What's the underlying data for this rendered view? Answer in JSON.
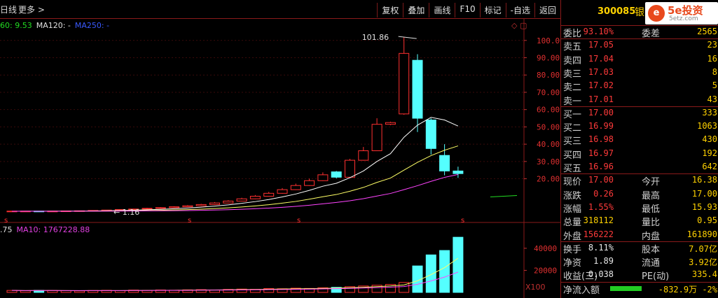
{
  "topbar": {
    "left_title": "日线",
    "more_label": "更多 >",
    "toolbar": [
      "复权",
      "叠加",
      "画线",
      "F10",
      "标记",
      "-自选",
      "返回"
    ]
  },
  "ma_line": [
    {
      "text": "60: 9.53",
      "color": "#22dd22"
    },
    {
      "text": "MA120: -",
      "color": "#e0e0e0"
    },
    {
      "text": "MA250: -",
      "color": "#3a5aff"
    }
  ],
  "vol_line": [
    {
      "text": ".75",
      "color": "#e0e0e0"
    },
    {
      "text": "MA10: 1767228.88",
      "color": "#e040e0"
    }
  ],
  "price_axis": {
    "ticks": [
      "100.00",
      "90.00",
      "80.00",
      "70.00",
      "60.00",
      "50.00",
      "40.00",
      "30.00",
      "20.00"
    ],
    "values": [
      100,
      90,
      80,
      70,
      60,
      50,
      40,
      30,
      20
    ]
  },
  "vol_axis": {
    "ticks": [
      "40000",
      "20000"
    ],
    "values": [
      40000,
      20000
    ],
    "unit": "X100"
  },
  "annotations": {
    "high": "101.86",
    "low": "1.16",
    "s_markers": [
      "s",
      "s",
      "s",
      "s"
    ]
  },
  "chart_data": {
    "type": "candlestick",
    "price_range": [
      0,
      108
    ],
    "candles": [
      {
        "o": 1.2,
        "c": 1.3,
        "h": 1.4,
        "l": 1.1
      },
      {
        "o": 1.3,
        "c": 1.3,
        "h": 1.4,
        "l": 1.2
      },
      {
        "o": 1.3,
        "c": 1.2,
        "h": 1.4,
        "l": 1.1
      },
      {
        "o": 1.2,
        "c": 1.3,
        "h": 1.4,
        "l": 1.16
      },
      {
        "o": 1.3,
        "c": 1.4,
        "h": 1.5,
        "l": 1.2
      },
      {
        "o": 1.4,
        "c": 1.5,
        "h": 1.6,
        "l": 1.3
      },
      {
        "o": 1.5,
        "c": 1.7,
        "h": 1.8,
        "l": 1.4
      },
      {
        "o": 1.7,
        "c": 1.9,
        "h": 2.0,
        "l": 1.6
      },
      {
        "o": 1.9,
        "c": 2.2,
        "h": 2.4,
        "l": 1.8
      },
      {
        "o": 2.2,
        "c": 2.5,
        "h": 2.7,
        "l": 2.0
      },
      {
        "o": 2.5,
        "c": 2.9,
        "h": 3.2,
        "l": 2.3
      },
      {
        "o": 2.9,
        "c": 3.3,
        "h": 3.6,
        "l": 2.7
      },
      {
        "o": 3.3,
        "c": 3.8,
        "h": 4.1,
        "l": 3.1
      },
      {
        "o": 3.8,
        "c": 4.4,
        "h": 4.8,
        "l": 3.6
      },
      {
        "o": 4.4,
        "c": 5.1,
        "h": 5.5,
        "l": 4.2
      },
      {
        "o": 5.1,
        "c": 6.0,
        "h": 6.5,
        "l": 4.9
      },
      {
        "o": 6.0,
        "c": 7.1,
        "h": 7.6,
        "l": 5.8
      },
      {
        "o": 7.1,
        "c": 8.4,
        "h": 9.0,
        "l": 6.9
      },
      {
        "o": 8.4,
        "c": 9.9,
        "h": 10.6,
        "l": 8.2
      },
      {
        "o": 9.9,
        "c": 11.6,
        "h": 12.4,
        "l": 9.7
      },
      {
        "o": 11.6,
        "c": 13.7,
        "h": 14.6,
        "l": 11.4
      },
      {
        "o": 13.7,
        "c": 16.1,
        "h": 17.2,
        "l": 13.5
      },
      {
        "o": 16.1,
        "c": 18.9,
        "h": 20.1,
        "l": 15.9
      },
      {
        "o": 18.9,
        "c": 22.3,
        "h": 23.7,
        "l": 18.7
      },
      {
        "o": 24.0,
        "c": 20.9,
        "h": 24.5,
        "l": 20.2
      },
      {
        "o": 20.9,
        "c": 30.7,
        "h": 31.5,
        "l": 20.9
      },
      {
        "o": 30.7,
        "c": 36.2,
        "h": 38.4,
        "l": 30.5
      },
      {
        "o": 36.2,
        "c": 51.5,
        "h": 55.0,
        "l": 36.0
      },
      {
        "o": 51.5,
        "c": 52.5,
        "h": 53.0,
        "l": 51.0
      },
      {
        "o": 57.5,
        "c": 92.5,
        "h": 101.86,
        "l": 57.0
      },
      {
        "o": 88.5,
        "c": 55.0,
        "h": 92.0,
        "l": 47.0
      },
      {
        "o": 54.0,
        "c": 37.5,
        "h": 55.0,
        "l": 34.0
      },
      {
        "o": 33.5,
        "c": 24.5,
        "h": 40.0,
        "l": 22.0
      },
      {
        "o": 24.5,
        "c": 23.0,
        "h": 27.0,
        "l": 20.5
      }
    ],
    "ma_fast": [
      1.2,
      1.25,
      1.25,
      1.25,
      1.28,
      1.33,
      1.4,
      1.5,
      1.65,
      1.82,
      2.05,
      2.35,
      2.7,
      3.1,
      3.6,
      4.2,
      4.9,
      5.8,
      6.8,
      8.0,
      9.5,
      11.2,
      13.3,
      15.7,
      17.4,
      20.6,
      24.5,
      30.0,
      34.5,
      44.0,
      51.0,
      55.5,
      54.0,
      50.5
    ],
    "ma_mid": [
      1.2,
      1.22,
      1.23,
      1.24,
      1.25,
      1.28,
      1.31,
      1.36,
      1.43,
      1.52,
      1.63,
      1.77,
      1.95,
      2.17,
      2.45,
      2.78,
      3.2,
      3.7,
      4.3,
      5.0,
      5.9,
      6.9,
      8.2,
      9.6,
      10.9,
      12.8,
      15.0,
      17.9,
      20.4,
      25.0,
      29.5,
      33.4,
      36.5,
      39.0
    ],
    "ma_slow": [
      1.2,
      1.21,
      1.22,
      1.22,
      1.23,
      1.24,
      1.26,
      1.28,
      1.31,
      1.35,
      1.4,
      1.46,
      1.54,
      1.64,
      1.77,
      1.93,
      2.13,
      2.38,
      2.68,
      3.05,
      3.5,
      4.05,
      4.7,
      5.5,
      6.3,
      7.3,
      8.5,
      10.0,
      11.5,
      13.7,
      16.0,
      18.5,
      20.8,
      22.5
    ],
    "volume": [
      1800,
      1500,
      1900,
      1700,
      1600,
      1400,
      1700,
      1900,
      1600,
      2100,
      1800,
      2200,
      2000,
      2300,
      2500,
      2200,
      2700,
      3000,
      2800,
      3500,
      3300,
      3800,
      3600,
      4200,
      4600,
      5200,
      5800,
      6500,
      7200,
      9000,
      24000,
      34000,
      38000,
      50000
    ]
  },
  "panel": {
    "code": "300085",
    "name": "银",
    "logo_text": "5e投资",
    "logo_sub": "5etz.com",
    "logo_mark": "e",
    "weibi": {
      "label": "委比",
      "value": "93.10%",
      "label2": "委差",
      "value2": "2565"
    },
    "asks": [
      {
        "label": "卖五",
        "price": "17.05",
        "vol": "23"
      },
      {
        "label": "卖四",
        "price": "17.04",
        "vol": "16"
      },
      {
        "label": "卖三",
        "price": "17.03",
        "vol": "8"
      },
      {
        "label": "卖二",
        "price": "17.02",
        "vol": "5"
      },
      {
        "label": "卖一",
        "price": "17.01",
        "vol": "43"
      }
    ],
    "bids": [
      {
        "label": "买一",
        "price": "17.00",
        "vol": "333"
      },
      {
        "label": "买二",
        "price": "16.99",
        "vol": "1063"
      },
      {
        "label": "买三",
        "price": "16.98",
        "vol": "430"
      },
      {
        "label": "买四",
        "price": "16.97",
        "vol": "192"
      },
      {
        "label": "买五",
        "price": "16.96",
        "vol": "642"
      }
    ],
    "quote": [
      {
        "l1": "现价",
        "v1": "17.00",
        "l2": "今开",
        "v2": "16.38"
      },
      {
        "l1": "涨跌",
        "v1": "0.26",
        "l2": "最高",
        "v2": "17.00"
      },
      {
        "l1": "涨幅",
        "v1": "1.55%",
        "l2": "最低",
        "v2": "15.93"
      },
      {
        "l1": "总量",
        "v1": "318112",
        "l2": "量比",
        "v2": "0.95"
      },
      {
        "l1": "外盘",
        "v1": "156222",
        "l2": "内盘",
        "v2": "161890"
      }
    ],
    "stats": [
      {
        "l1": "换手",
        "v1": "8.11%",
        "l2": "股本",
        "v2": "7.07亿"
      },
      {
        "l1": "净资",
        "v1": "1.89",
        "l2": "流通",
        "v2": "3.92亿"
      },
      {
        "l1": "收益(三)",
        "v1": "0.038",
        "l2": "PE(动)",
        "v2": "335.4"
      }
    ],
    "flow": {
      "label": "净流入额",
      "value": "-832.9万",
      "pct": "-2%"
    }
  }
}
